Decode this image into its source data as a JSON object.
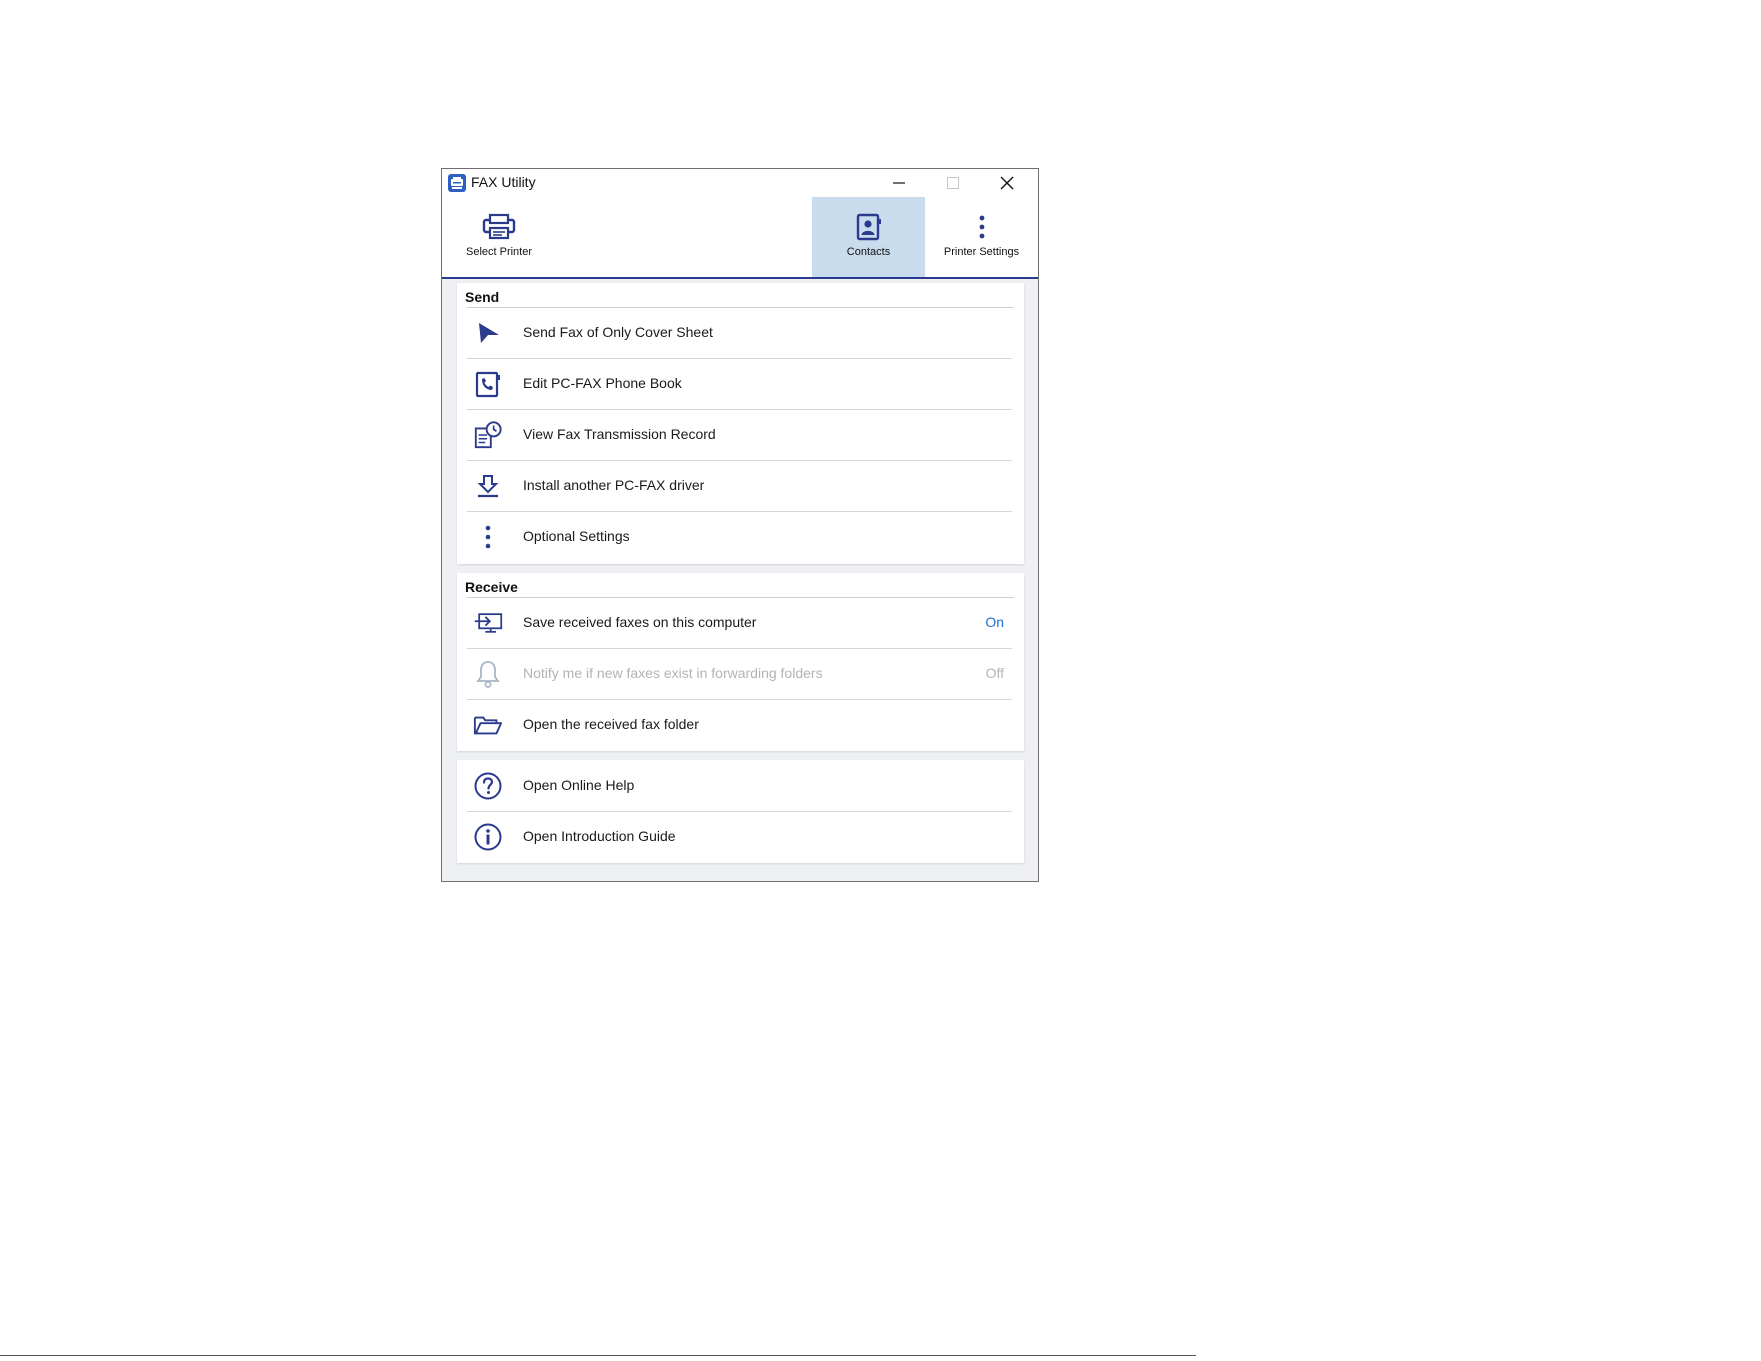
{
  "window": {
    "title": "FAX Utility",
    "controls": {
      "minimize": "minimize-icon",
      "maximize": "maximize-icon",
      "close": "close-icon"
    }
  },
  "toolbar": {
    "select_printer": "Select Printer",
    "contacts": "Contacts",
    "printer_settings": "Printer Settings"
  },
  "send": {
    "title": "Send",
    "items": [
      {
        "label": "Send Fax of Only Cover Sheet",
        "icon": "send-arrow-icon"
      },
      {
        "label": "Edit PC-FAX Phone Book",
        "icon": "phone-book-icon"
      },
      {
        "label": "View Fax Transmission Record",
        "icon": "transmission-record-icon"
      },
      {
        "label": "Install another PC-FAX driver",
        "icon": "download-icon"
      },
      {
        "label": "Optional Settings",
        "icon": "more-vertical-icon"
      }
    ]
  },
  "receive": {
    "title": "Receive",
    "items": [
      {
        "label": "Save received faxes on this computer",
        "state": "On",
        "icon": "save-to-computer-icon"
      },
      {
        "label": "Notify me if new faxes exist in forwarding folders",
        "state": "Off",
        "icon": "bell-icon",
        "disabled": true
      },
      {
        "label": "Open the received fax folder",
        "icon": "folder-open-icon"
      }
    ]
  },
  "help": {
    "items": [
      {
        "label": "Open Online Help",
        "icon": "help-icon"
      },
      {
        "label": "Open Introduction Guide",
        "icon": "info-icon"
      }
    ]
  },
  "colors": {
    "accent": "#2a3a8c",
    "selected_tab": "#c9dcee",
    "state_on": "#1e6ecf",
    "disabled": "#b3b3b3",
    "content_bg": "#eef0f3"
  }
}
